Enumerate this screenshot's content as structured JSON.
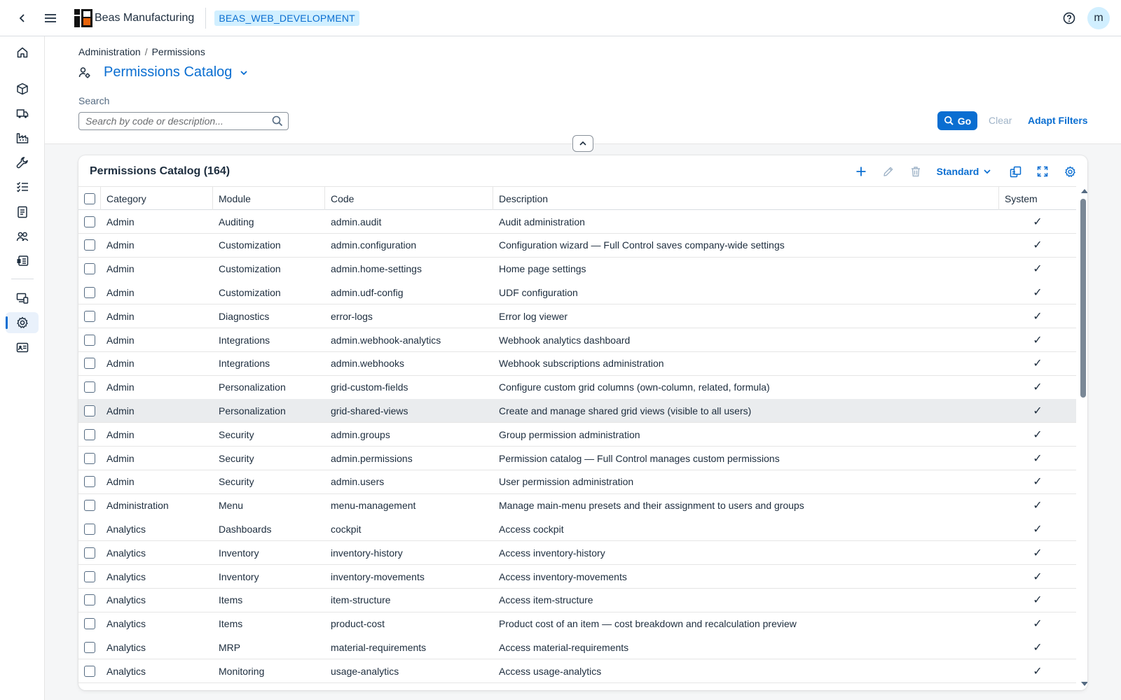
{
  "shell": {
    "brand": "Beas Manufacturing",
    "system": "BEAS_WEB_DEVELOPMENT",
    "avatar": "m",
    "icons": [
      "back-icon",
      "hamburger-icon",
      "help-icon"
    ]
  },
  "sidebar": {
    "items": [
      {
        "name": "home-icon"
      },
      {
        "name": "cube-icon"
      },
      {
        "name": "truck-icon"
      },
      {
        "name": "factory-icon"
      },
      {
        "name": "wrench-icon"
      },
      {
        "name": "checklist-icon"
      },
      {
        "name": "document-icon"
      },
      {
        "name": "group-icon"
      },
      {
        "name": "report-icon"
      },
      {
        "name": "devices-icon"
      },
      {
        "name": "gear-icon",
        "active": true
      },
      {
        "name": "id-card-icon"
      }
    ]
  },
  "header": {
    "breadcrumb": [
      "Administration",
      "Permissions"
    ],
    "title": "Permissions Catalog",
    "search_label": "Search",
    "search_placeholder": "Search by code or description...",
    "go_label": "Go",
    "clear_label": "Clear",
    "adapt_label": "Adapt Filters"
  },
  "table": {
    "title": "Permissions Catalog (164)",
    "variant": "Standard",
    "columns": [
      "Category",
      "Module",
      "Code",
      "Description",
      "System"
    ],
    "check_glyph": "✓",
    "rows": [
      {
        "category": "Admin",
        "module": "Auditing",
        "code": "admin.audit",
        "description": "Audit administration",
        "system": true
      },
      {
        "category": "Admin",
        "module": "Customization",
        "code": "admin.configuration",
        "description": "Configuration wizard — Full Control saves company-wide settings",
        "system": true
      },
      {
        "category": "Admin",
        "module": "Customization",
        "code": "admin.home-settings",
        "description": "Home page settings",
        "system": true
      },
      {
        "category": "Admin",
        "module": "Customization",
        "code": "admin.udf-config",
        "description": "UDF configuration",
        "system": true
      },
      {
        "category": "Admin",
        "module": "Diagnostics",
        "code": "error-logs",
        "description": "Error log viewer",
        "system": true
      },
      {
        "category": "Admin",
        "module": "Integrations",
        "code": "admin.webhook-analytics",
        "description": "Webhook analytics dashboard",
        "system": true
      },
      {
        "category": "Admin",
        "module": "Integrations",
        "code": "admin.webhooks",
        "description": "Webhook subscriptions administration",
        "system": true
      },
      {
        "category": "Admin",
        "module": "Personalization",
        "code": "grid-custom-fields",
        "description": "Configure custom grid columns (own-column, related, formula)",
        "system": true
      },
      {
        "category": "Admin",
        "module": "Personalization",
        "code": "grid-shared-views",
        "description": "Create and manage shared grid views (visible to all users)",
        "system": true,
        "highlighted": true
      },
      {
        "category": "Admin",
        "module": "Security",
        "code": "admin.groups",
        "description": "Group permission administration",
        "system": true
      },
      {
        "category": "Admin",
        "module": "Security",
        "code": "admin.permissions",
        "description": "Permission catalog — Full Control manages custom permissions",
        "system": true
      },
      {
        "category": "Admin",
        "module": "Security",
        "code": "admin.users",
        "description": "User permission administration",
        "system": true
      },
      {
        "category": "Administration",
        "module": "Menu",
        "code": "menu-management",
        "description": "Manage main-menu presets and their assignment to users and groups",
        "system": true
      },
      {
        "category": "Analytics",
        "module": "Dashboards",
        "code": "cockpit",
        "description": "Access cockpit",
        "system": true
      },
      {
        "category": "Analytics",
        "module": "Inventory",
        "code": "inventory-history",
        "description": "Access inventory-history",
        "system": true
      },
      {
        "category": "Analytics",
        "module": "Inventory",
        "code": "inventory-movements",
        "description": "Access inventory-movements",
        "system": true
      },
      {
        "category": "Analytics",
        "module": "Items",
        "code": "item-structure",
        "description": "Access item-structure",
        "system": true
      },
      {
        "category": "Analytics",
        "module": "Items",
        "code": "product-cost",
        "description": "Product cost of an item — cost breakdown and recalculation preview",
        "system": true
      },
      {
        "category": "Analytics",
        "module": "MRP",
        "code": "material-requirements",
        "description": "Access material-requirements",
        "system": true
      },
      {
        "category": "Analytics",
        "module": "Monitoring",
        "code": "usage-analytics",
        "description": "Access usage-analytics",
        "system": true
      }
    ]
  },
  "colors": {
    "accent": "#0a6ed1",
    "badge_bg": "#d1efff",
    "row_highlight": "#eaecee"
  }
}
